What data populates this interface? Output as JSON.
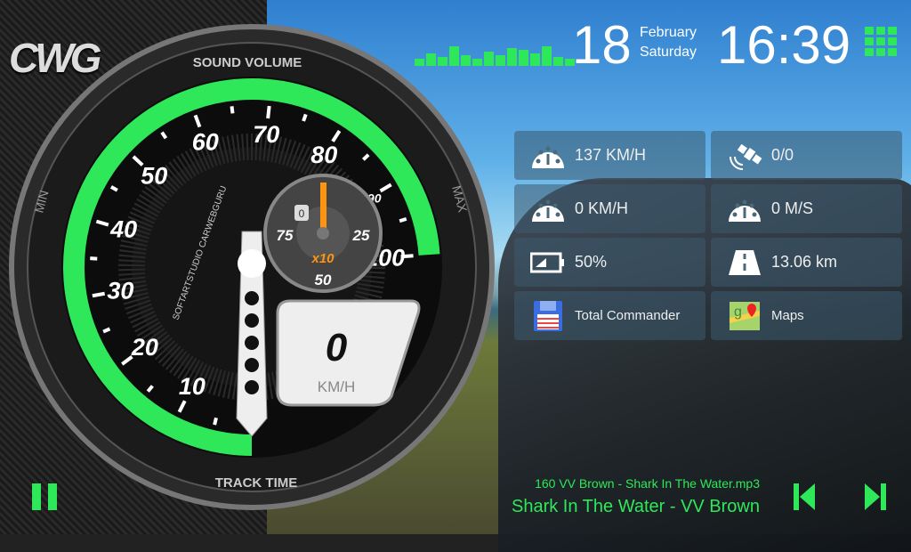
{
  "logo": "CWG",
  "date": {
    "day": "18",
    "month": "February",
    "weekday": "Saturday"
  },
  "clock": "16:39",
  "gauge": {
    "top_label": "SOUND VOLUME",
    "bottom_label": "TRACK TIME",
    "min_label": "MIN",
    "max_label": "MAX",
    "brand": "SOFTARTSTUDIO CARWEBGURU",
    "scale": [
      "10",
      "20",
      "30",
      "40",
      "50",
      "60",
      "70",
      "80",
      "90",
      "100"
    ],
    "speed": "0",
    "unit": "KM/H",
    "sub_scale": [
      "25",
      "50",
      "75"
    ],
    "sub_multiplier": "x10",
    "odometer": "0",
    "accent": "#2ee85a"
  },
  "tiles": [
    {
      "icon": "speedometer-icon",
      "label": "137 KM/H"
    },
    {
      "icon": "satellite-icon",
      "label": "0/0"
    },
    {
      "icon": "speedometer-icon",
      "label": "0 KM/H"
    },
    {
      "icon": "speedometer-icon",
      "label": "0 M/S"
    },
    {
      "icon": "battery-icon",
      "label": "50%"
    },
    {
      "icon": "road-icon",
      "label": "13.06 km"
    },
    {
      "icon": "floppy-icon",
      "label": "Total Commander"
    },
    {
      "icon": "maps-icon",
      "label": "Maps"
    }
  ],
  "player": {
    "file": "160 VV Brown - Shark In The Water.mp3",
    "title": "Shark In The Water - VV Brown"
  }
}
